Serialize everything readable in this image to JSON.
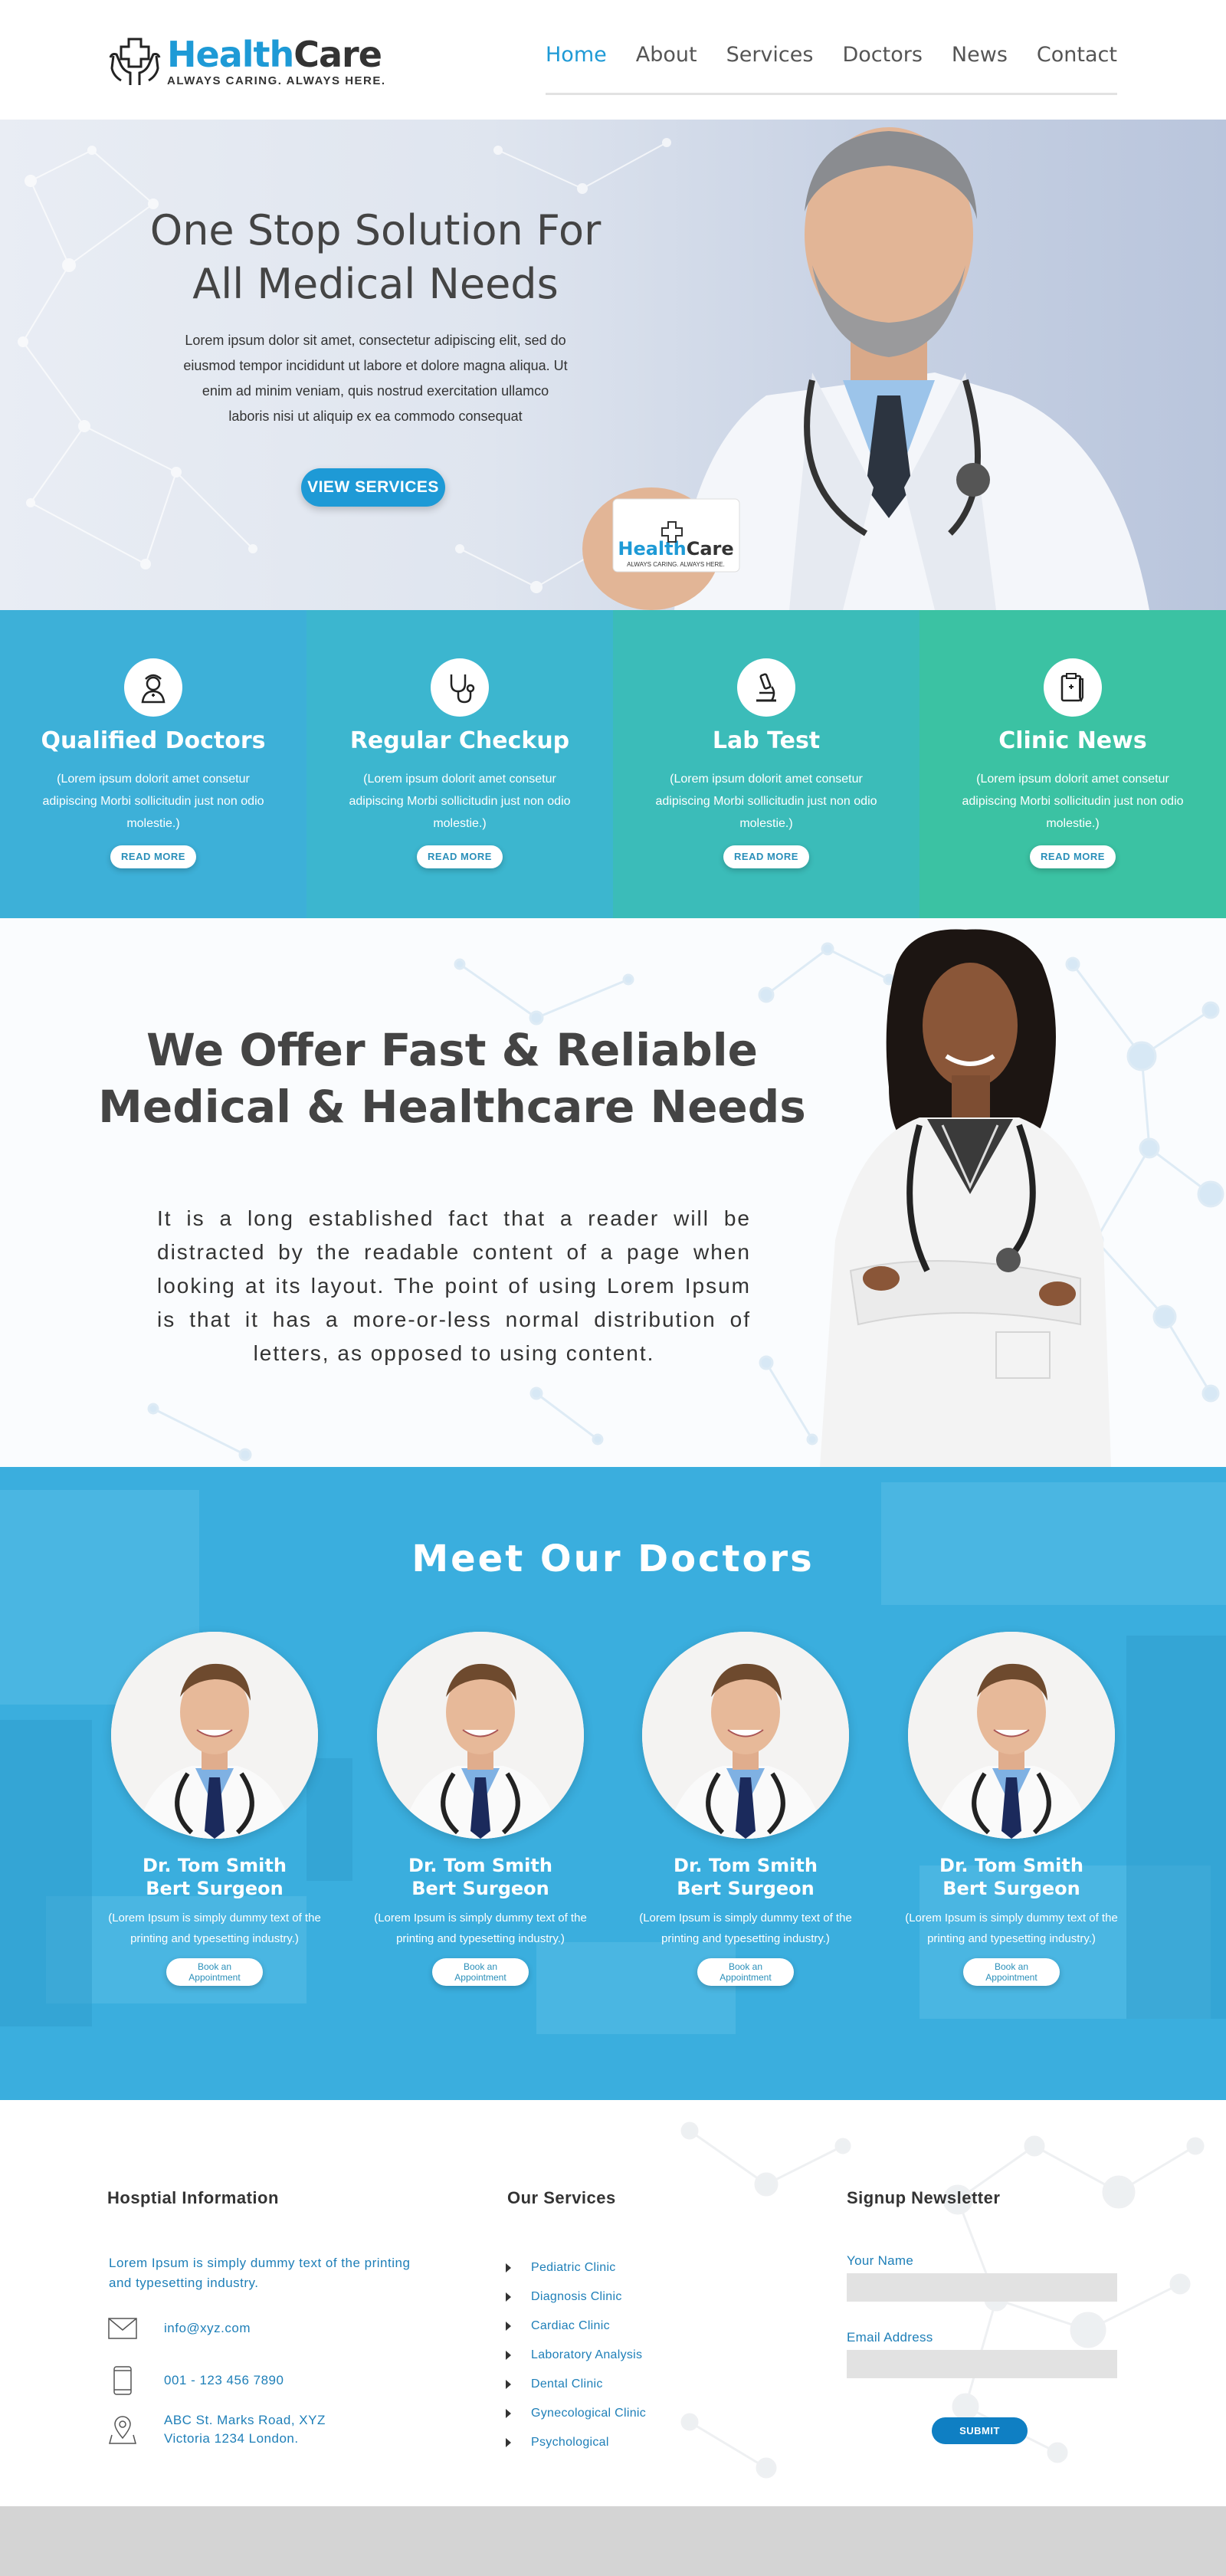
{
  "header": {
    "logo": {
      "title_part1": "Health",
      "title_part2": "Care",
      "tagline": "ALWAYS CARING. ALWAYS HERE."
    },
    "nav": [
      {
        "label": "Home",
        "active": true
      },
      {
        "label": "About",
        "active": false
      },
      {
        "label": "Services",
        "active": false
      },
      {
        "label": "Doctors",
        "active": false
      },
      {
        "label": "News",
        "active": false
      },
      {
        "label": "Contact",
        "active": false
      }
    ]
  },
  "hero": {
    "title_line1": "One Stop Solution For",
    "title_line2": "All Medical Needs",
    "text": "Lorem ipsum dolor sit amet, consectetur adipiscing elit, sed do eiusmod tempor incididunt ut labore et dolore magna aliqua. Ut enim ad minim veniam, quis nostrud exercitation ullamco laboris nisi ut aliquip ex ea commodo consequat",
    "button": "VIEW SERVICES",
    "card_logo": {
      "title_part1": "Health",
      "title_part2": "Care",
      "tagline": "ALWAYS CARING. ALWAYS HERE."
    }
  },
  "features": [
    {
      "icon": "nurse-icon",
      "title": "Qualified Doctors",
      "text": "(Lorem ipsum dolorit amet consetur adipiscing Morbi sollicitudin just non odio molestie.)",
      "button": "READ MORE",
      "color": "#3db0d8"
    },
    {
      "icon": "stethoscope-icon",
      "title": "Regular Checkup",
      "text": "(Lorem ipsum dolorit amet consetur adipiscing Morbi sollicitudin just non odio molestie.)",
      "button": "READ MORE",
      "color": "#3cb6cf"
    },
    {
      "icon": "microscope-icon",
      "title": "Lab Test",
      "text": "(Lorem ipsum dolorit amet consetur adipiscing Morbi sollicitudin just non odio molestie.)",
      "button": "READ MORE",
      "color": "#3bbcb9"
    },
    {
      "icon": "clipboard-icon",
      "title": "Clinic News",
      "text": "(Lorem ipsum dolorit amet consetur adipiscing Morbi sollicitudin just non odio molestie.)",
      "button": "READ MORE",
      "color": "#3bc2a3"
    }
  ],
  "offer": {
    "title_line1": "We Offer Fast & Reliable",
    "title_line2": "Medical & Healthcare Needs",
    "text": "It is a long established fact that a reader will be distracted by the readable content of a page when looking at its layout. The point of using Lorem Ipsum is that it has a more-or-less normal distribution of letters, as opposed to using content."
  },
  "meet": {
    "title": "Meet Our Doctors",
    "doctors": [
      {
        "name_line1": "Dr. Tom Smith",
        "name_line2": "Bert Surgeon",
        "text": "(Lorem Ipsum is simply dummy text of the printing and typesetting industry.)",
        "button": "Book an\nAppointment"
      },
      {
        "name_line1": "Dr. Tom Smith",
        "name_line2": "Bert Surgeon",
        "text": "(Lorem Ipsum is simply dummy text of the printing and typesetting industry.)",
        "button": "Book an\nAppointment"
      },
      {
        "name_line1": "Dr. Tom Smith",
        "name_line2": "Bert Surgeon",
        "text": "(Lorem Ipsum is simply dummy text of the printing and typesetting industry.)",
        "button": "Book an\nAppointment"
      },
      {
        "name_line1": "Dr. Tom Smith",
        "name_line2": "Bert Surgeon",
        "text": "(Lorem Ipsum is simply dummy text of the printing and typesetting industry.)",
        "button": "Book an\nAppointment"
      }
    ]
  },
  "footer": {
    "info": {
      "heading": "Hosptial Information",
      "about": "Lorem Ipsum is simply dummy text of the printing and typesetting industry.",
      "email": "info@xyz.com",
      "phone": "001 - 123 456 7890",
      "address": "ABC St. Marks Road, XYZ\nVictoria 1234 London."
    },
    "services": {
      "heading": "Our Services",
      "items": [
        "Pediatric Clinic",
        "Diagnosis Clinic",
        "Cardiac Clinic",
        "Laboratory Analysis",
        "Dental Clinic",
        "Gynecological Clinic",
        "Psychological"
      ]
    },
    "newsletter": {
      "heading": "Signup Newsletter",
      "name_label": "Your Name",
      "email_label": "Email Address",
      "name_value": "",
      "email_value": "",
      "submit": "SUBMIT"
    }
  }
}
